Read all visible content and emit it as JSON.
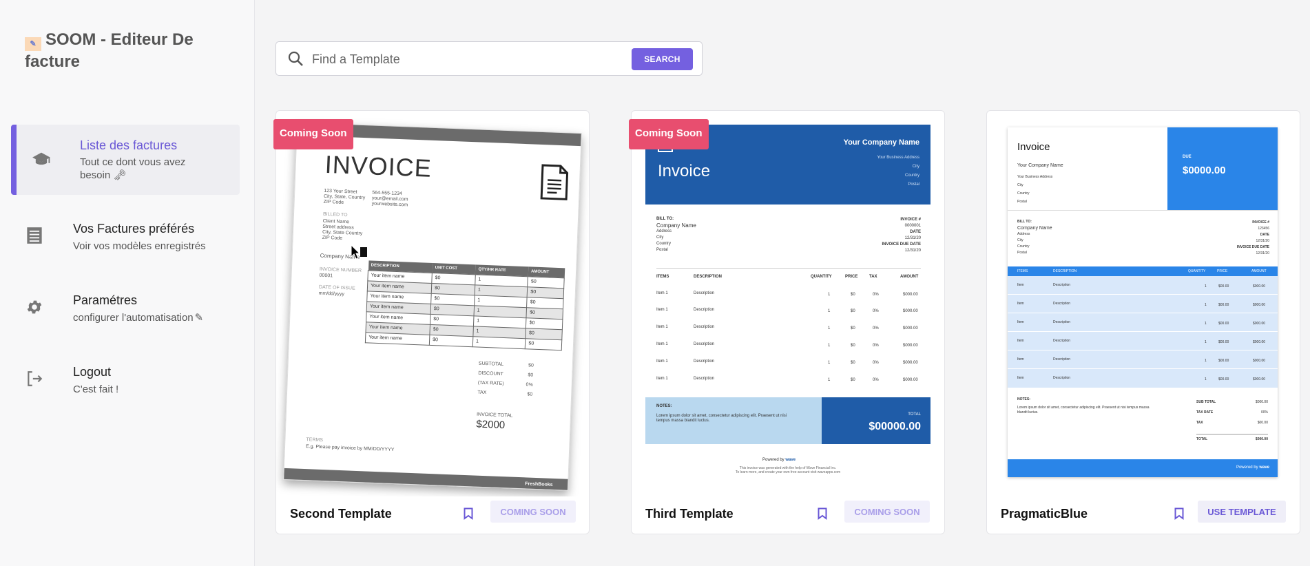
{
  "app": {
    "title": "SOOM - Editeur De facture"
  },
  "sidebar": {
    "items": [
      {
        "title": "Liste des factures",
        "subtitle": "Tout ce dont vous avez besoin",
        "icon": "graduation-cap-icon",
        "active": true
      },
      {
        "title": "Vos Factures préférés",
        "subtitle": "Voir vos modèles enregistrés",
        "icon": "document-list-icon",
        "active": false
      },
      {
        "title": "Paramétres",
        "subtitle": "configurer l'automatisation",
        "icon": "gear-icon",
        "active": false
      },
      {
        "title": "Logout",
        "subtitle": "C'est fait !",
        "icon": "logout-icon",
        "active": false
      }
    ]
  },
  "search": {
    "placeholder": "Find a Template",
    "button_label": "SEARCH"
  },
  "colors": {
    "accent": "#7460e0",
    "badge": "#e84e6f",
    "wave_blue": "#1f5ca8",
    "pragmatic_blue": "#2a85e8"
  },
  "cards": [
    {
      "name": "Second Template",
      "badge": "Coming Soon",
      "button_label": "COMING SOON"
    },
    {
      "name": "Third Template",
      "badge": "Coming Soon",
      "button_label": "COMING SOON"
    },
    {
      "name": "PragmaticBlue",
      "badge": "",
      "button_label": "USE TEMPLATE"
    }
  ],
  "preview1": {
    "title": "INVOICE",
    "address": [
      "123 Your Street",
      "City, State, Country",
      "ZIP Code"
    ],
    "contact": [
      "564-555-1234",
      "your@email.com",
      "yourwebsite.com"
    ],
    "billed_to_label": "BILLED TO",
    "billed_to": [
      "Client Name",
      "Street address",
      "City, State Country",
      "ZIP Code"
    ],
    "company": "Company Name",
    "invoice_number_label": "INVOICE NUMBER",
    "invoice_number": "00001",
    "date_label": "DATE OF ISSUE",
    "date": "mm/dd/yyyy",
    "columns": [
      "DESCRIPTION",
      "UNIT COST",
      "QTY/HR RATE",
      "AMOUNT"
    ],
    "rows": [
      [
        "Your item name",
        "$0",
        "1",
        "$0"
      ],
      [
        "Your item name",
        "$0",
        "1",
        "$0"
      ],
      [
        "Your item name",
        "$0",
        "1",
        "$0"
      ],
      [
        "Your item name",
        "$0",
        "1",
        "$0"
      ],
      [
        "Your item name",
        "$0",
        "1",
        "$0"
      ],
      [
        "Your item name",
        "$0",
        "1",
        "$0"
      ],
      [
        "Your item name",
        "$0",
        "1",
        "$0"
      ]
    ],
    "subtotal_label": "SUBTOTAL",
    "subtotal": "$0",
    "discount_label": "DISCOUNT",
    "discount": "$0",
    "taxrate_label": "(TAX RATE)",
    "taxrate": "0%",
    "tax_label": "TAX",
    "tax": "$0",
    "total_label": "INVOICE TOTAL",
    "total": "$2000",
    "terms_label": "TERMS",
    "terms": "E.g. Please pay invoice by MM/DD/YYYY",
    "brand": "FreshBooks"
  },
  "preview2": {
    "company": "Your Company Name",
    "title": "Invoice",
    "addr": [
      "Your Business Address",
      "City",
      "Country",
      "Postal"
    ],
    "bill_to": "BILL TO:",
    "client": [
      "Company Name",
      "Address",
      "City",
      "Country",
      "Postal"
    ],
    "meta": [
      "INVOICE #",
      "0000001",
      "DATE",
      "12/31/20",
      "INVOICE DUE DATE",
      "12/31/20"
    ],
    "cols": [
      "ITEMS",
      "DESCRIPTION",
      "QUANTITY",
      "PRICE",
      "TAX",
      "AMOUNT"
    ],
    "rows": [
      [
        "Item 1",
        "Description",
        "1",
        "$0",
        "0%",
        "$000.00"
      ],
      [
        "Item 1",
        "Description",
        "1",
        "$0",
        "0%",
        "$000.00"
      ],
      [
        "Item 1",
        "Description",
        "1",
        "$0",
        "0%",
        "$000.00"
      ],
      [
        "Item 1",
        "Description",
        "1",
        "$0",
        "0%",
        "$000.00"
      ],
      [
        "Item 1",
        "Description",
        "1",
        "$0",
        "0%",
        "$000.00"
      ],
      [
        "Item 1",
        "Description",
        "1",
        "$0",
        "0%",
        "$000.00"
      ]
    ],
    "notes_label": "NOTES:",
    "notes": "Lorem ipsum dolor sit amet, consectetur adipiscing elit. Praesent ut nisi tempus massa blandit luctus.",
    "total_label": "TOTAL",
    "total": "$00000.00",
    "powered": "Powered by",
    "wave": "wave",
    "footnote1": "This invoice was generated with the help of Wave Financial Inc.",
    "footnote2": "To learn more, and create your own free account visit waveapps.com"
  },
  "preview3": {
    "title": "Invoice",
    "company": "Your Company Name",
    "addr": [
      "Your Business Address",
      "City",
      "Country",
      "Postal"
    ],
    "due_label": "DUE",
    "due": "$0000.00",
    "bill_to": "BILL TO:",
    "client": [
      "Company Name",
      "Address",
      "City",
      "Country",
      "Postal"
    ],
    "meta": [
      "INVOICE #",
      "123456",
      "DATE",
      "12/31/20",
      "INVOICE DUE DATE",
      "12/31/20"
    ],
    "cols": [
      "ITEMS",
      "DESCRIPTION",
      "QUANTITY",
      "PRICE",
      "AMOUNT"
    ],
    "rows": [
      [
        "Item",
        "Description",
        "1",
        "$00.00",
        "$000.00"
      ],
      [
        "Item",
        "Description",
        "1",
        "$00.00",
        "$000.00"
      ],
      [
        "Item",
        "Description",
        "1",
        "$00.00",
        "$000.00"
      ],
      [
        "Item",
        "Description",
        "1",
        "$00.00",
        "$000.00"
      ],
      [
        "Item",
        "Description",
        "1",
        "$00.00",
        "$000.00"
      ],
      [
        "Item",
        "Description",
        "1",
        "$00.00",
        "$000.00"
      ]
    ],
    "notes_label": "NOTES:",
    "notes": "Lorem ipsum dolor sit amet, consectetur adipiscing elit. Praesent ut nisi tempus massa blandit luctus.",
    "sub_total_label": "SUB TOTAL",
    "sub_total": "$000.00",
    "tax_rate_label": "TAX RATE",
    "tax_rate": "00%",
    "tax_label": "TAX",
    "tax": "$00.00",
    "total_label": "TOTAL",
    "total": "$000.00",
    "powered": "Powered by",
    "wave": "wave"
  }
}
